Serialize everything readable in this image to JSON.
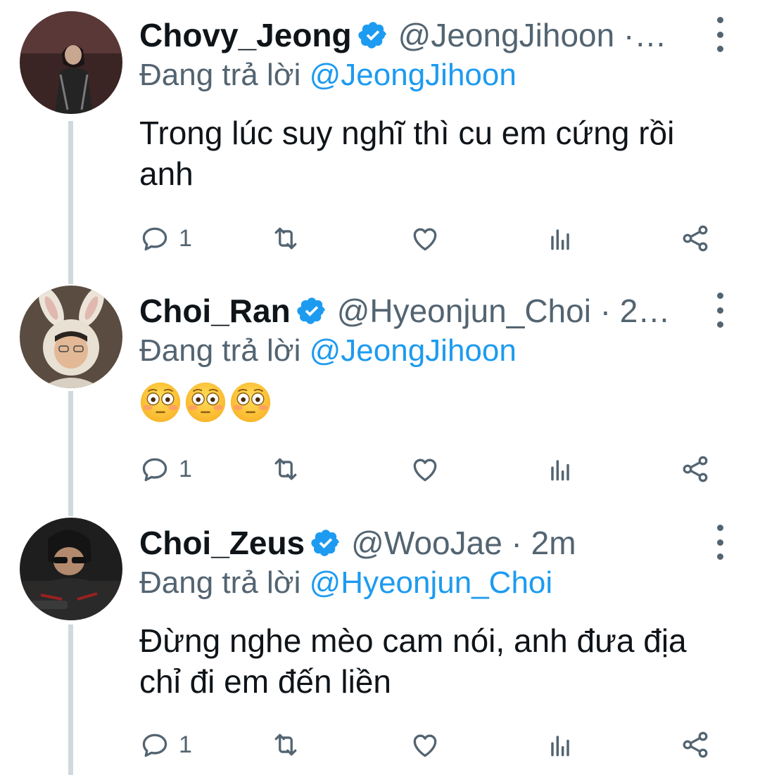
{
  "tweets": [
    {
      "name": "Chovy_Jeong",
      "handle": "@JeongJihoon ·…",
      "replying_prefix": "Đang trả lời ",
      "replying_to": "@JeongJihoon",
      "text": "Trong lúc suy nghĩ thì cu em cứng rồi anh",
      "reply_count": "1"
    },
    {
      "name": "Choi_Ran",
      "handle": "@Hyeonjun_Choi · 2…",
      "replying_prefix": "Đang trả lời ",
      "replying_to": "@JeongJihoon",
      "emojis": [
        "flushed-face",
        "flushed-face",
        "flushed-face"
      ],
      "reply_count": "1"
    },
    {
      "name": "Choi_Zeus",
      "handle": "@WooJae · 2m",
      "replying_prefix": "Đang trả lời ",
      "replying_to": "@Hyeonjun_Choi",
      "text": "Đừng nghe mèo cam nói, anh đưa địa chỉ đi em đến liền",
      "reply_count": "1"
    }
  ],
  "colors": {
    "primary_text": "#0f1419",
    "secondary_text": "#536471",
    "link": "#1d9bf0",
    "verified": "#1d9bf0",
    "thread_line": "#cfd9de"
  },
  "icons": [
    "verified-badge-icon",
    "more-options-icon",
    "reply-icon",
    "retweet-icon",
    "like-icon",
    "analytics-icon",
    "share-icon"
  ]
}
